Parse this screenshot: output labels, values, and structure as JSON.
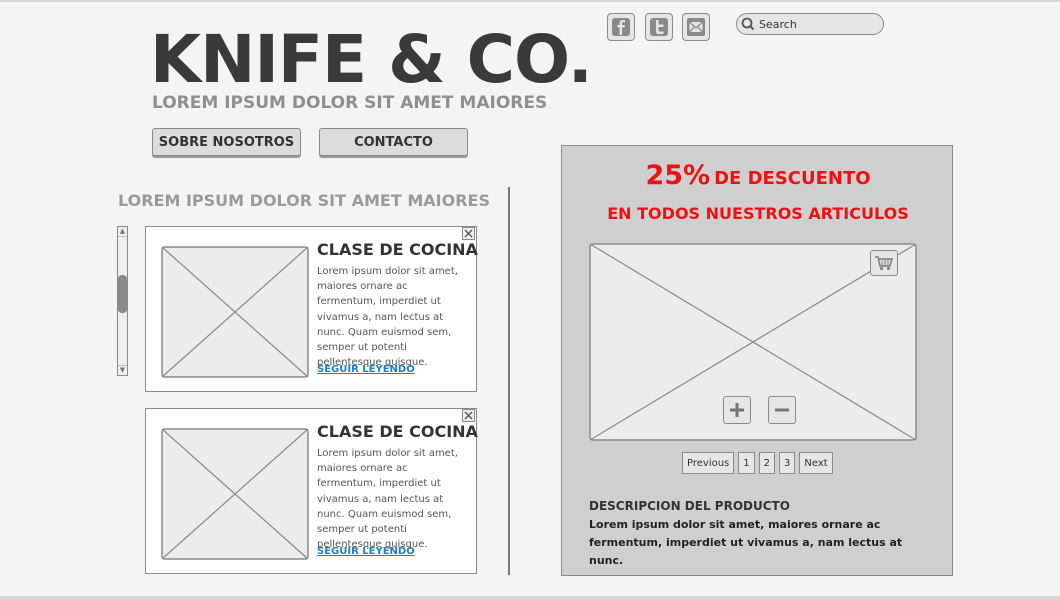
{
  "brand": {
    "logo": "KNIFE & CO.",
    "tagline": "LOREM IPSUM DOLOR SIT AMET MAIORES"
  },
  "nav": {
    "about_label": "SOBRE NOSOTROS",
    "contact_label": "CONTACTO"
  },
  "header": {
    "social_icons": [
      "facebook-icon",
      "twitter-icon",
      "mail-icon"
    ],
    "search_placeholder": "Search"
  },
  "main": {
    "heading": "LOREM IPSUM DOLOR SIT AMET MAIORES",
    "articles": [
      {
        "title": "CLASE DE COCINA",
        "body": "Lorem ipsum dolor sit amet, maiores ornare ac fermentum, imperdiet ut vivamus a, nam lectus at nunc. Quam euismod sem, semper ut potenti pellentesque quisque.",
        "link": "SEGUIR LEYENDO"
      },
      {
        "title": "CLASE DE COCINA",
        "body": "Lorem ipsum dolor sit amet, maiores ornare ac fermentum, imperdiet ut vivamus a, nam lectus at nunc. Quam euismod sem, semper ut potenti pellentesque quisque.",
        "link": "SEGUIR LEYENDO"
      }
    ]
  },
  "promo": {
    "percent": "25%",
    "line1": "DE DESCUENTO",
    "line2": "EN TODOS NUESTROS ARTICULOS",
    "pagination": {
      "previous": "Previous",
      "pages": [
        "1",
        "2",
        "3"
      ],
      "next": "Next"
    },
    "product_title": "DESCRIPCION DEL PRODUCTO",
    "product_text": "Lorem ipsum dolor sit amet, maiores ornare ac fermentum, imperdiet ut vivamus a, nam lectus at nunc."
  },
  "colors": {
    "accent": "#ee1111",
    "link": "#1d7fc1",
    "panel": "#cfcfcf",
    "background": "#f4f4f4"
  }
}
